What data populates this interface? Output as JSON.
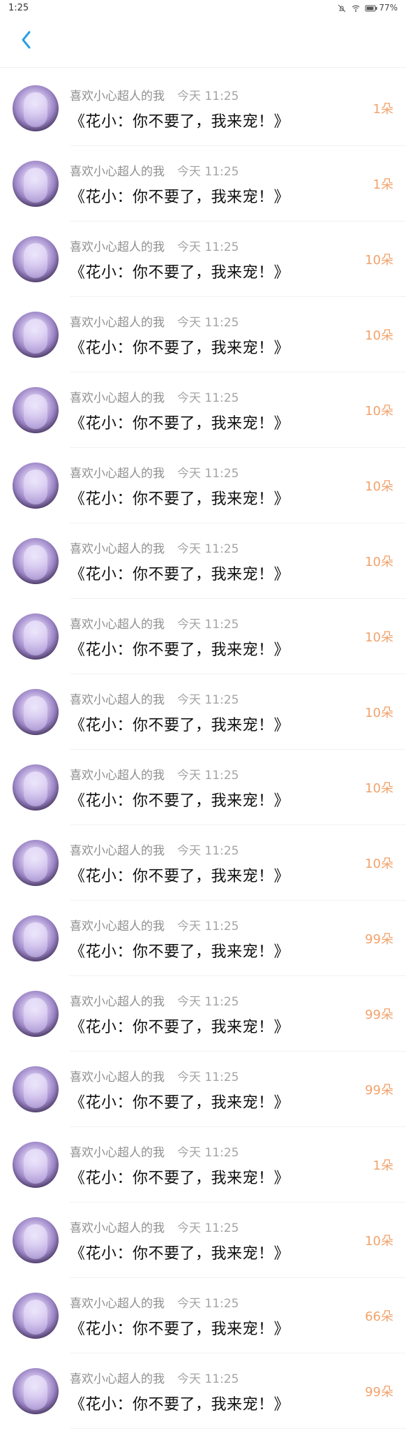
{
  "status": {
    "time": "1:25",
    "battery": "77%",
    "icons": [
      "bell-off-icon",
      "wifi-icon",
      "battery-icon"
    ]
  },
  "header": {
    "back_icon": "chevron-left-icon"
  },
  "items": [
    {
      "username": "喜欢小心超人的我",
      "time": "今天 11:25",
      "title": "《花小：你不要了，我来宠！》",
      "amount": "1朵"
    },
    {
      "username": "喜欢小心超人的我",
      "time": "今天 11:25",
      "title": "《花小：你不要了，我来宠！》",
      "amount": "1朵"
    },
    {
      "username": "喜欢小心超人的我",
      "time": "今天 11:25",
      "title": "《花小：你不要了，我来宠！》",
      "amount": "10朵"
    },
    {
      "username": "喜欢小心超人的我",
      "time": "今天 11:25",
      "title": "《花小：你不要了，我来宠！》",
      "amount": "10朵"
    },
    {
      "username": "喜欢小心超人的我",
      "time": "今天 11:25",
      "title": "《花小：你不要了，我来宠！》",
      "amount": "10朵"
    },
    {
      "username": "喜欢小心超人的我",
      "time": "今天 11:25",
      "title": "《花小：你不要了，我来宠！》",
      "amount": "10朵"
    },
    {
      "username": "喜欢小心超人的我",
      "time": "今天 11:25",
      "title": "《花小：你不要了，我来宠！》",
      "amount": "10朵"
    },
    {
      "username": "喜欢小心超人的我",
      "time": "今天 11:25",
      "title": "《花小：你不要了，我来宠！》",
      "amount": "10朵"
    },
    {
      "username": "喜欢小心超人的我",
      "time": "今天 11:25",
      "title": "《花小：你不要了，我来宠！》",
      "amount": "10朵"
    },
    {
      "username": "喜欢小心超人的我",
      "time": "今天 11:25",
      "title": "《花小：你不要了，我来宠！》",
      "amount": "10朵"
    },
    {
      "username": "喜欢小心超人的我",
      "time": "今天 11:25",
      "title": "《花小：你不要了，我来宠！》",
      "amount": "10朵"
    },
    {
      "username": "喜欢小心超人的我",
      "time": "今天 11:25",
      "title": "《花小：你不要了，我来宠！》",
      "amount": "99朵"
    },
    {
      "username": "喜欢小心超人的我",
      "time": "今天 11:25",
      "title": "《花小：你不要了，我来宠！》",
      "amount": "99朵"
    },
    {
      "username": "喜欢小心超人的我",
      "time": "今天 11:25",
      "title": "《花小：你不要了，我来宠！》",
      "amount": "99朵"
    },
    {
      "username": "喜欢小心超人的我",
      "time": "今天 11:25",
      "title": "《花小：你不要了，我来宠！》",
      "amount": "1朵"
    },
    {
      "username": "喜欢小心超人的我",
      "time": "今天 11:25",
      "title": "《花小：你不要了，我来宠！》",
      "amount": "10朵"
    },
    {
      "username": "喜欢小心超人的我",
      "time": "今天 11:25",
      "title": "《花小：你不要了，我来宠！》",
      "amount": "66朵"
    },
    {
      "username": "喜欢小心超人的我",
      "time": "今天 11:25",
      "title": "《花小：你不要了，我来宠！》",
      "amount": "99朵"
    }
  ]
}
